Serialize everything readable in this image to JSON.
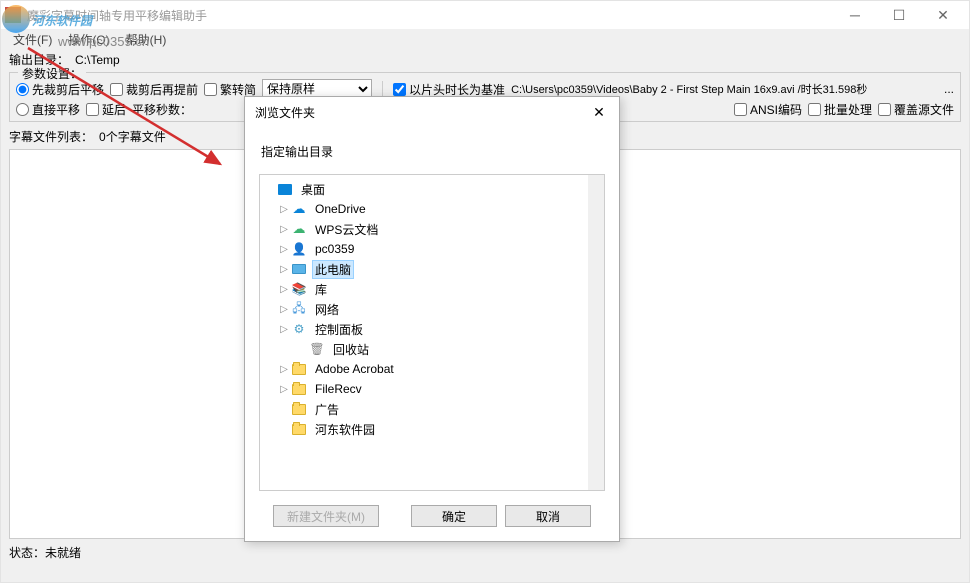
{
  "window": {
    "title": "魔彩字幕时间轴专用平移编辑助手",
    "min_icon": "─",
    "max_icon": "☐",
    "close_icon": "✕"
  },
  "menu": {
    "file": "文件(F)",
    "operate": "操作(O)",
    "help": "帮助(H)"
  },
  "watermark": {
    "main": "河东软件园",
    "sub": "www.pc0359.cn"
  },
  "output": {
    "label": "输出目录：",
    "path": "C:\\Temp"
  },
  "params": {
    "title": "参数设置：",
    "opt1": "先裁剪后平移",
    "opt2": "裁剪后再提前",
    "opt3": "繁转简",
    "combo_value": "保持原样",
    "check_clip": "以片头时长为基准",
    "video_info": "C:\\Users\\pc0359\\Videos\\Baby 2 - First Step Main 16x9.avi  /时长31.598秒",
    "direct_shift": "直接平移",
    "delay": "延后",
    "shift_label": "平移秒数：",
    "ansi": "ANSI编码",
    "batch": "批量处理",
    "overwrite": "覆盖源文件"
  },
  "list": {
    "label": "字幕文件列表：",
    "count": "0个字幕文件"
  },
  "status": {
    "label": "状态：",
    "value": "未就绪"
  },
  "dialog": {
    "title": "浏览文件夹",
    "prompt": "指定输出目录",
    "close_icon": "✕",
    "tree": {
      "desktop": "桌面",
      "onedrive": "OneDrive",
      "wps": "WPS云文档",
      "user": "pc0359",
      "thispc": "此电脑",
      "lib": "库",
      "network": "网络",
      "control": "控制面板",
      "recycle": "回收站",
      "adobe": "Adobe Acrobat",
      "filerecv": "FileRecv",
      "ad": "广告",
      "hedong": "河东软件园"
    },
    "newfolder": "新建文件夹(M)",
    "ok": "确定",
    "cancel": "取消"
  }
}
